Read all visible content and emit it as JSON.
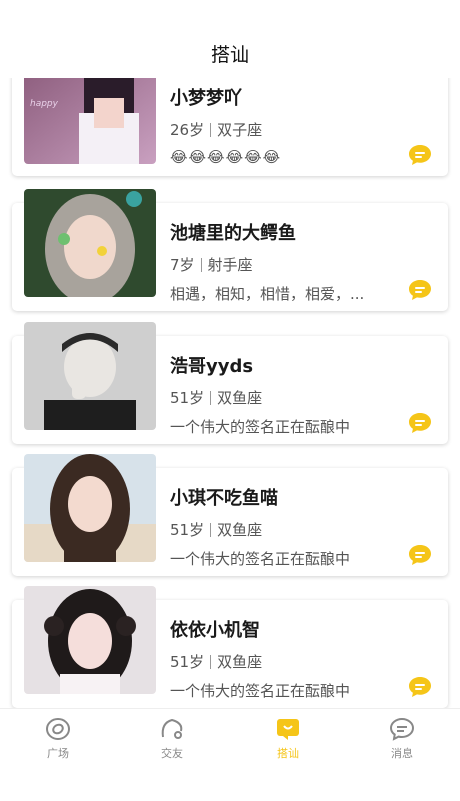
{
  "header": {
    "title": "搭讪"
  },
  "users": [
    {
      "name": "小梦梦吖",
      "age": "26岁",
      "sign": "双子座",
      "signature": "😂😂😂😂😂😂"
    },
    {
      "name": "池塘里的大鳄鱼",
      "age": "7岁",
      "sign": "射手座",
      "signature": "相遇，相知，相惜，相爱，..."
    },
    {
      "name": "浩哥yyds",
      "age": "51岁",
      "sign": "双鱼座",
      "signature": "一个伟大的签名正在酝酿中"
    },
    {
      "name": "小琪不吃鱼喵",
      "age": "51岁",
      "sign": "双鱼座",
      "signature": "一个伟大的签名正在酝酿中"
    },
    {
      "name": "依依小机智",
      "age": "51岁",
      "sign": "双鱼座",
      "signature": "一个伟大的签名正在酝酿中"
    }
  ],
  "tabs": [
    {
      "label": "广场",
      "icon": "plaza-icon"
    },
    {
      "label": "交友",
      "icon": "friends-icon"
    },
    {
      "label": "搭讪",
      "icon": "chat-bubble-icon"
    },
    {
      "label": "消息",
      "icon": "message-icon"
    }
  ],
  "colors": {
    "accent": "#F5C518",
    "inactive": "#888888"
  }
}
